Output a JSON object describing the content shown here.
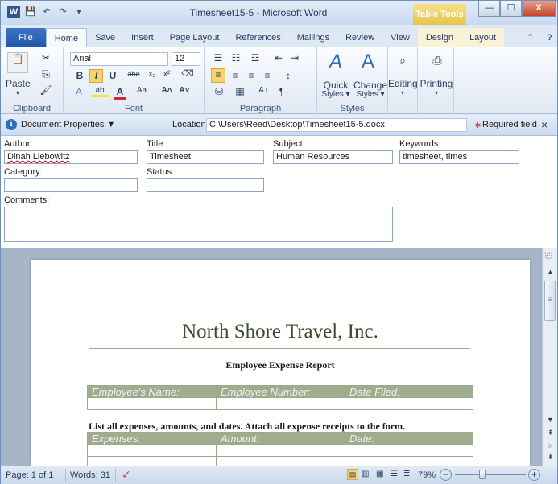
{
  "window": {
    "title": "Timesheet15-5 - Microsoft Word",
    "context_tab_group": "Table Tools",
    "controls": {
      "minimize": "—",
      "maximize": "☐",
      "close": "X"
    }
  },
  "quick_access": {
    "app_icon": "W",
    "save": "💾",
    "undo": "↶",
    "redo": "↷",
    "customize": "▾"
  },
  "tabs": [
    "File",
    "Home",
    "Save",
    "Insert",
    "Page Layout",
    "References",
    "Mailings",
    "Review",
    "View",
    "Design",
    "Layout"
  ],
  "help": "?",
  "ribbon": {
    "clipboard": {
      "label": "Clipboard",
      "paste": "Paste"
    },
    "font": {
      "label": "Font",
      "name": "Arial",
      "size": "12",
      "bold": "B",
      "italic": "I",
      "underline": "U",
      "strike": "abe",
      "sub": "x₂",
      "sup": "x²",
      "grow": "A˄",
      "shrink": "A˅",
      "case": "Aa"
    },
    "paragraph": {
      "label": "Paragraph",
      "sort": "A↓",
      "pilcrow": "¶"
    },
    "styles": {
      "label": "Styles",
      "quick": "Quick",
      "quick2": "Styles ▾",
      "change": "Change",
      "change2": "Styles ▾"
    },
    "editing": {
      "label": "Editing"
    },
    "printing": {
      "label": "Printing"
    }
  },
  "docprops": {
    "title": "Document Properties ▼",
    "location_label": "Location:",
    "location_value": "C:\\Users\\Reed\\Desktop\\Timesheet15-5.docx",
    "required": "Required field",
    "required_star": "∗",
    "close": "×",
    "author_label": "Author:",
    "author_value": "Dinah Liebowitz",
    "title_label": "Title:",
    "title_value": "Timesheet",
    "subject_label": "Subject:",
    "subject_value": "Human Resources",
    "keywords_label": "Keywords:",
    "keywords_value": "timesheet, times",
    "category_label": "Category:",
    "category_value": "",
    "status_label": "Status:",
    "status_value": "",
    "comments_label": "Comments:",
    "comments_value": ""
  },
  "document": {
    "company": "North Shore Travel, Inc.",
    "heading": "Employee Expense Report",
    "table1_headers": [
      "Employee's Name:",
      "Employee Number:",
      "Date Filed:"
    ],
    "instruction": "List all expenses, amounts, and dates. Attach all expense receipts to the form.",
    "table2_headers": [
      "Expenses:",
      "Amount:",
      "Date:"
    ]
  },
  "status": {
    "page": "Page: 1 of 1",
    "words": "Words: 31",
    "zoom": "79%",
    "zoom_level_percent": 79
  },
  "colors": {
    "accent": "#2b5797",
    "table_header": "#9fac8d",
    "context_tab": "#e8c44a"
  }
}
